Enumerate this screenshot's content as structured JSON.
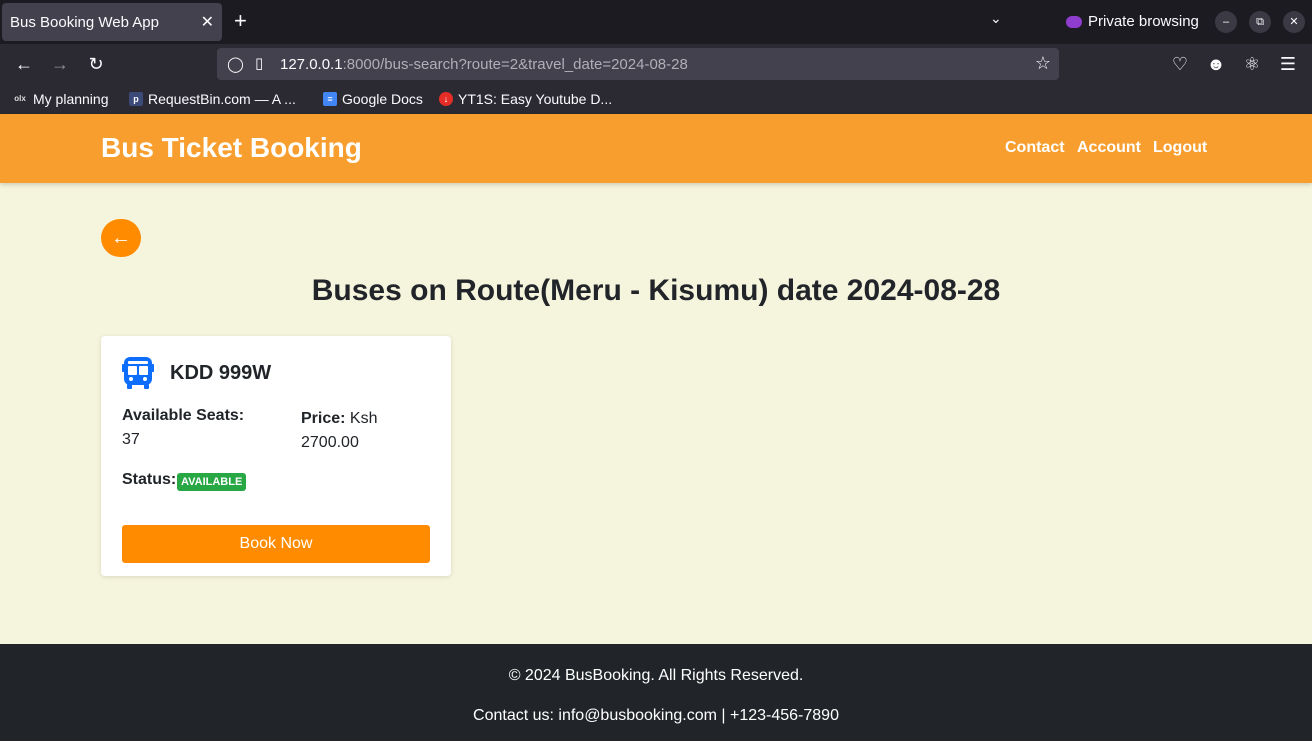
{
  "browser": {
    "tab_title": "Bus Booking Web App",
    "tab_close": "✕",
    "new_tab": "+",
    "private_label": "Private browsing",
    "url_host": "127.0.0.1",
    "url_rest": ":8000/bus-search?route=2&travel_date=2024-08-28",
    "bookmarks": [
      {
        "label": "My planning",
        "icon": "olx"
      },
      {
        "label": "RequestBin.com — A ...",
        "icon": "p"
      },
      {
        "label": "Google Docs",
        "icon": "docs"
      },
      {
        "label": "YT1S: Easy Youtube D...",
        "icon": "yt1s"
      }
    ]
  },
  "header": {
    "brand": "Bus Ticket Booking",
    "nav": [
      "Contact",
      "Account",
      "Logout"
    ]
  },
  "main": {
    "back_icon": "arrow-left-icon",
    "title": "Buses on Route(Meru - Kisumu) date 2024-08-28",
    "buses": [
      {
        "plate": "KDD 999W",
        "seats_label": "Available Seats:",
        "seats": "37",
        "price_label": "Price:",
        "price": "Ksh 2700.00",
        "status_label": "Status:",
        "status": "AVAILABLE",
        "book_label": "Book Now"
      }
    ]
  },
  "footer": {
    "copyright": "© 2024 BusBooking. All Rights Reserved.",
    "contact": "Contact us: info@busbooking.com | +123-456-7890"
  },
  "colors": {
    "header": "#f79e2e",
    "accent": "#ff8c00",
    "page_bg": "#f5f4dc",
    "status_green": "#28a745",
    "footer_bg": "#212529",
    "bus_icon": "#0d6efd"
  }
}
